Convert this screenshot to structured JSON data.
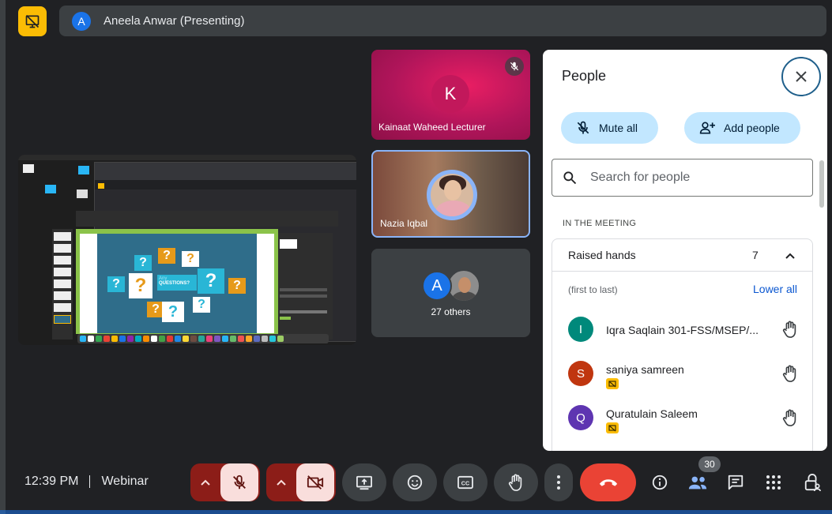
{
  "presenter": {
    "avatar_letter": "A",
    "banner_text": "Aneela Anwar (Presenting)"
  },
  "shared_screen": {
    "slide_text": "QUESTIONS?",
    "slide_subtext": "Any"
  },
  "tiles": [
    {
      "name": "Kainaat Waheed Lecturer",
      "avatar_letter": "K",
      "muted": true
    },
    {
      "name": "Nazia Iqbal",
      "active_speaker": true
    },
    {
      "avatar_letter": "A",
      "label": "27 others"
    }
  ],
  "people_panel": {
    "title": "People",
    "mute_all_label": "Mute all",
    "add_people_label": "Add people",
    "search_placeholder": "Search for people",
    "section_label": "IN THE MEETING",
    "raised_hands": {
      "label": "Raised hands",
      "count": "7",
      "order_hint": "(first to last)",
      "lower_all_label": "Lower all",
      "people": [
        {
          "name": "Iqra Saqlain 301-FSS/MSEP/...",
          "avatar_letter": "I",
          "color": "#00897b",
          "presenting_badge": false
        },
        {
          "name": "saniya samreen",
          "avatar_letter": "S",
          "color": "#c0360f",
          "presenting_badge": true
        },
        {
          "name": "Quratulain Saleem",
          "avatar_letter": "Q",
          "color": "#5e35b1",
          "presenting_badge": true
        }
      ]
    }
  },
  "bottom_bar": {
    "time": "12:39 PM",
    "meeting_name": "Webinar",
    "participant_count": "30"
  },
  "colors": {
    "accent_blue": "#8ab4f8",
    "leave_red": "#ea4335",
    "presenting_yellow": "#fbbc04"
  }
}
